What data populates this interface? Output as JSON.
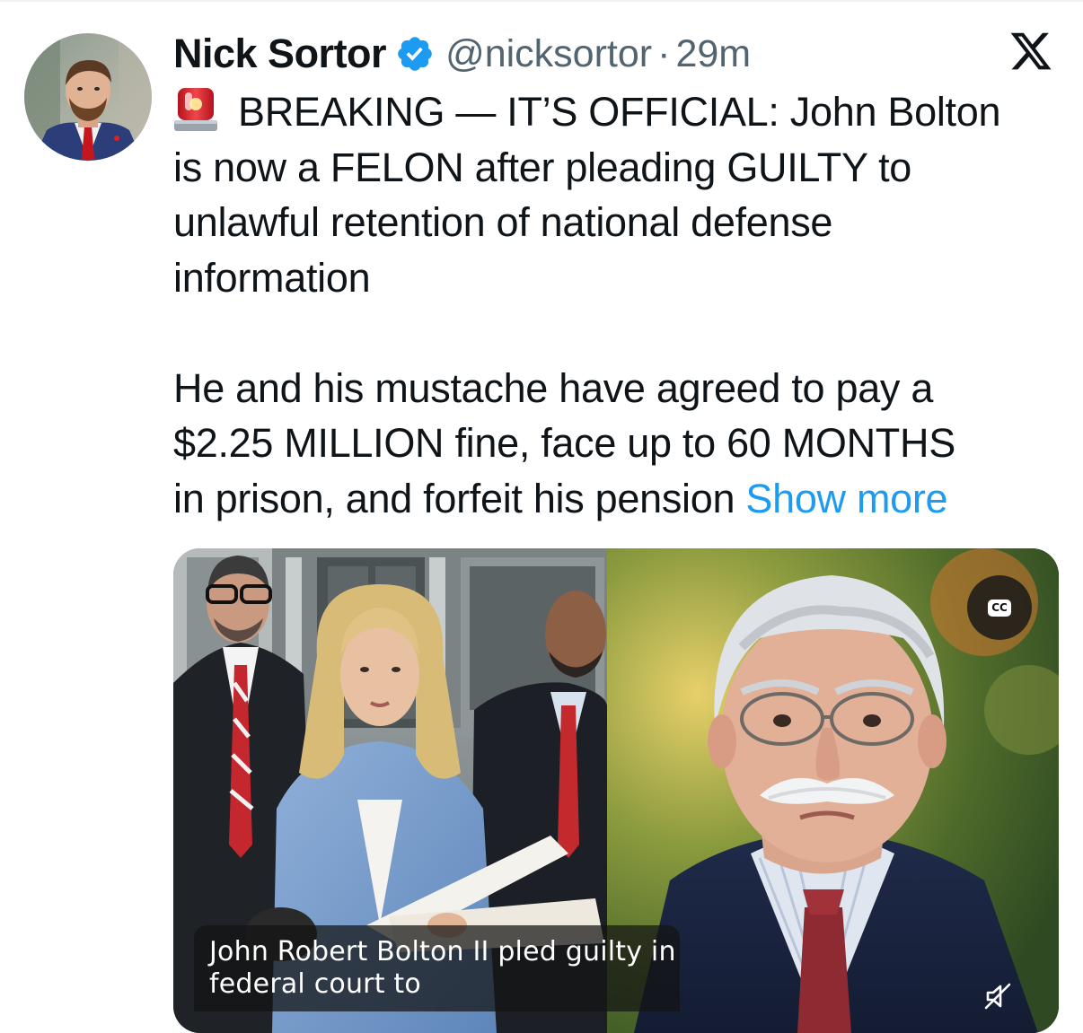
{
  "tweet": {
    "author": {
      "display_name": "Nick Sortor",
      "handle": "@nicksortor",
      "separator": "·",
      "time": "29m",
      "verified": true
    },
    "text": {
      "line1_after_emoji": "BREAKING — IT’S OFFICIAL: John Bolton",
      "line2": "is now a FELON after pleading GUILTY to",
      "line3": "unlawful retention of national defense",
      "line4": "information",
      "para2_line1": "He and his mustache have agreed to pay a",
      "para2_line2": "$2.25 MILLION fine, face up to 60 MONTHS",
      "para2_line3": "in prison, and forfeit his pension",
      "show_more": "Show more"
    },
    "emoji": "rotating-light-emoji",
    "media": {
      "type": "video",
      "cc_label": "CC",
      "caption_line1": "John Robert Bolton II pled guilty in",
      "caption_line2": "federal court to",
      "muted": true
    }
  },
  "colors": {
    "link": "#1d9bf0",
    "secondary": "#536471",
    "verified": "#1d9bf0"
  }
}
